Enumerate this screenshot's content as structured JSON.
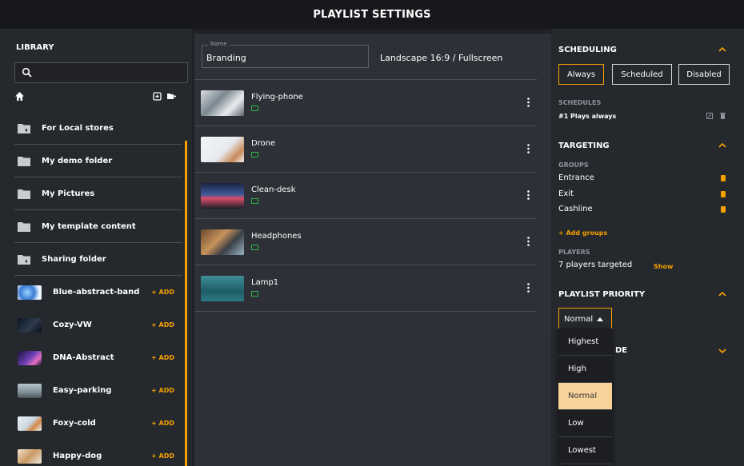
{
  "header": {
    "title": "PLAYLIST SETTINGS"
  },
  "library": {
    "title": "LIBRARY",
    "search_placeholder": "",
    "folders": [
      {
        "label": "For Local stores"
      },
      {
        "label": "My demo folder"
      },
      {
        "label": "My Pictures"
      },
      {
        "label": "My template content"
      },
      {
        "label": "Sharing folder"
      }
    ],
    "media": [
      {
        "label": "Blue-abstract-band",
        "add": "+ ADD"
      },
      {
        "label": "Cozy-VW",
        "add": "+ ADD"
      },
      {
        "label": "DNA-Abstract",
        "add": "+ ADD"
      },
      {
        "label": "Easy-parking",
        "add": "+ ADD"
      },
      {
        "label": "Foxy-cold",
        "add": "+ ADD"
      },
      {
        "label": "Happy-dog",
        "add": "+ ADD"
      }
    ]
  },
  "editor": {
    "name_label": "Name",
    "name_value": "Branding",
    "orientation": "Landscape 16:9 / Fullscreen",
    "items": [
      {
        "title": "Flying-phone"
      },
      {
        "title": "Drone"
      },
      {
        "title": "Clean-desk"
      },
      {
        "title": "Headphones"
      },
      {
        "title": "Lamp1"
      }
    ]
  },
  "scheduling": {
    "title": "SCHEDULING",
    "options": [
      "Always",
      "Scheduled",
      "Disabled"
    ],
    "active": "Always",
    "schedules_label": "SCHEDULES",
    "schedule_item": "#1  Plays always"
  },
  "targeting": {
    "title": "TARGETING",
    "groups_label": "GROUPS",
    "groups": [
      "Entrance",
      "Exit",
      "Cashline"
    ],
    "add_groups": "+ Add groups",
    "players_label": "PLAYERS",
    "players_text": "7 players targeted",
    "show": "Show"
  },
  "priority": {
    "title": "PLAYLIST PRIORITY",
    "selected": "Normal",
    "options": [
      "Highest",
      "High",
      "Normal",
      "Low",
      "Lowest"
    ],
    "hidden_section_suffix": "DE"
  },
  "colors": {
    "accent": "#f5a100",
    "ok": "#2fb24c"
  }
}
